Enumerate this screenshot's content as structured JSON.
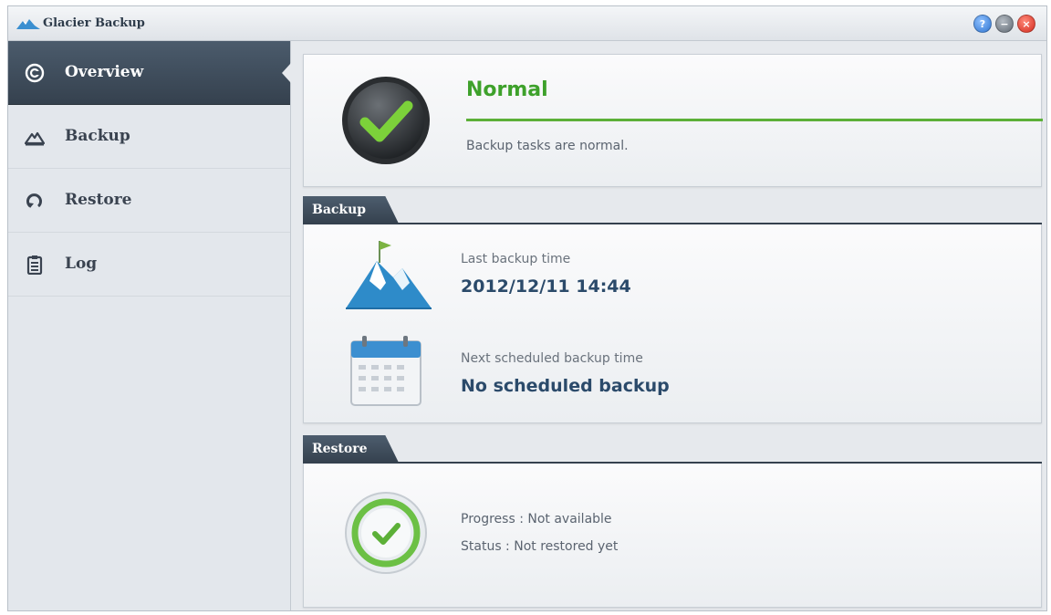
{
  "window": {
    "title": "Glacier Backup",
    "help_glyph": "?",
    "minimize_glyph": "−",
    "close_glyph": "×"
  },
  "sidebar": {
    "items": [
      {
        "label": "Overview",
        "icon": "overview-icon",
        "active": true
      },
      {
        "label": "Backup",
        "icon": "mountain-icon",
        "active": false
      },
      {
        "label": "Restore",
        "icon": "restore-arrow-icon",
        "active": false
      },
      {
        "label": "Log",
        "icon": "clipboard-icon",
        "active": false
      }
    ]
  },
  "status": {
    "title": "Normal",
    "description": "Backup tasks are normal.",
    "color": "#3ea12b"
  },
  "backup": {
    "tab_label": "Backup",
    "last_label": "Last backup time",
    "last_value": "2012/12/11 14:44",
    "next_label": "Next scheduled backup time",
    "next_value": "No scheduled backup"
  },
  "restore": {
    "tab_label": "Restore",
    "progress": "Progress : Not available",
    "status": "Status : Not restored yet"
  },
  "colors": {
    "accent_dark": "#35414e",
    "value_blue": "#2b4a6a",
    "ok_green": "#5cb038"
  }
}
